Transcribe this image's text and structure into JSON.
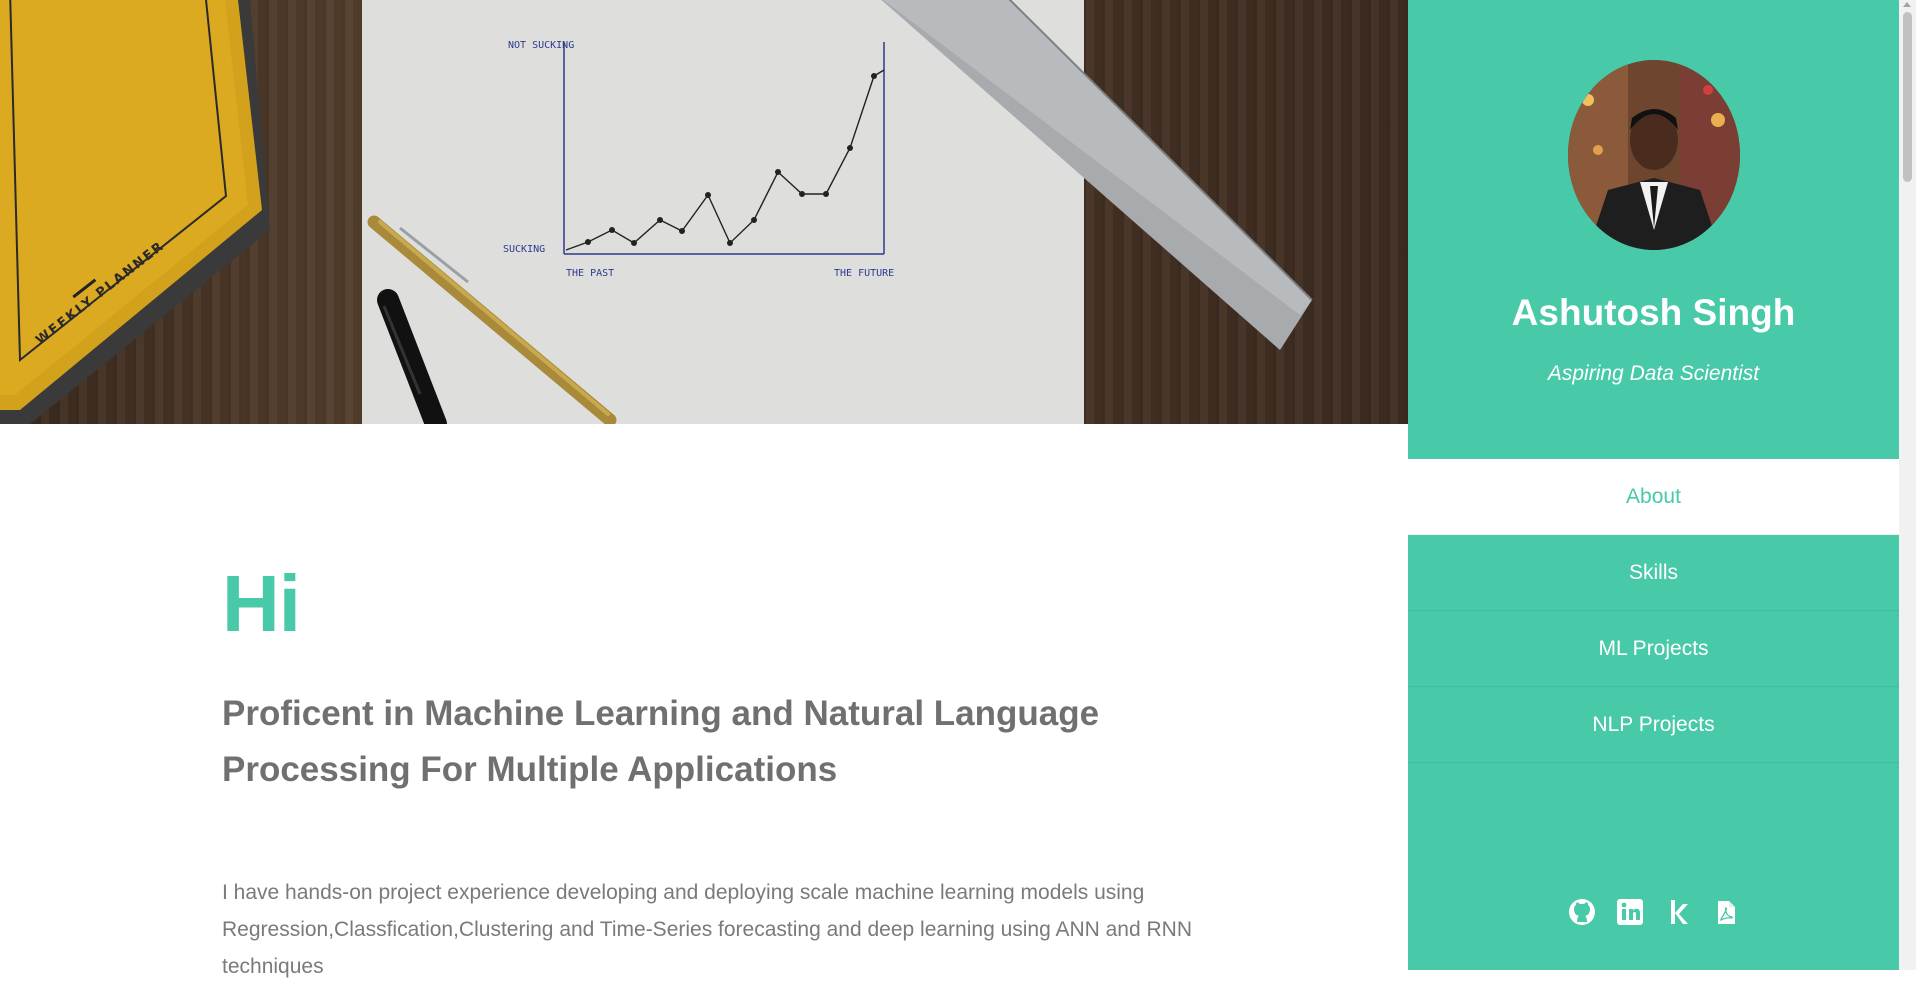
{
  "hero": {
    "chart_top_label": "NOT SUCKING",
    "chart_bottom_label": "SUCKING",
    "chart_left_label": "THE PAST",
    "chart_right_label": "THE FUTURE",
    "planner_label": "WEEKLY PLANNER"
  },
  "main": {
    "greeting": "Hi",
    "tagline": "Proficent in Machine Learning and Natural Language Processing For Multiple Applications",
    "intro": "I have hands-on project experience developing and deploying scale machine learning models using Regression,Classfication,Clustering and Time-Series forecasting and deep learning using ANN and RNN techniques"
  },
  "sidebar": {
    "name": "Ashutosh Singh",
    "role": "Aspiring Data Scientist",
    "nav": [
      {
        "label": "About",
        "active": true
      },
      {
        "label": "Skills",
        "active": false
      },
      {
        "label": "ML Projects",
        "active": false
      },
      {
        "label": "NLP Projects",
        "active": false
      }
    ],
    "social": [
      "github-icon",
      "linkedin-icon",
      "kaggle-icon",
      "pdf-resume-icon"
    ]
  },
  "colors": {
    "accent": "#48c9a7",
    "text_gray": "#707070"
  }
}
